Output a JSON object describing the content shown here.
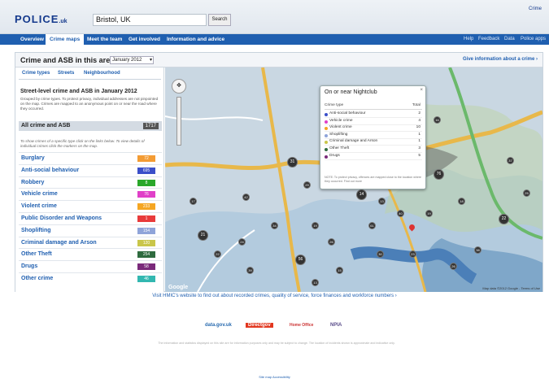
{
  "header": {
    "logo": "POLICE",
    "logo_suffix": ".uk",
    "search_value": "Bristol, UK",
    "search_button": "Search",
    "top_right_link": "Crime"
  },
  "nav": {
    "items": [
      "Overview",
      "Crime maps",
      "Meet the team",
      "Get involved",
      "Information and advice"
    ],
    "right_items": [
      "Help",
      "Feedback",
      "Data",
      "Police apps"
    ],
    "active": "Crime maps"
  },
  "panel": {
    "title": "Crime and ASB in this area in",
    "month": "January 2012",
    "info_link": "Give information about a crime ›"
  },
  "sidebar": {
    "tabs": [
      "Crime types",
      "Streets",
      "Neighbourhood"
    ],
    "heading": "Street-level crime and ASB in January 2012",
    "description": "Grouped by crime types. To protect privacy, individual addresses are not pinpointed on the map. Crimes are mapped to an anonymous point on or near the road where they occurred.",
    "all": {
      "label": "All crime and ASB",
      "count": "1717"
    },
    "hint": "To show crimes of a specific type click on the links below. To view details of individual crimes click the markers on the map.",
    "items": [
      {
        "label": "Burglary",
        "count": "72",
        "color": "#f39c34"
      },
      {
        "label": "Anti-social behaviour",
        "count": "695",
        "color": "#3a4fc9"
      },
      {
        "label": "Robbery",
        "count": "8",
        "color": "#2aa72a"
      },
      {
        "label": "Vehicle crime",
        "count": "76",
        "color": "#e040c8"
      },
      {
        "label": "Violent crime",
        "count": "233",
        "color": "#f5a623"
      },
      {
        "label": "Public Disorder and Weapons",
        "count": "1",
        "color": "#e83b3b"
      },
      {
        "label": "Shoplifting",
        "count": "154",
        "color": "#8fa4d9"
      },
      {
        "label": "Criminal damage and Arson",
        "count": "120",
        "color": "#c9c64a"
      },
      {
        "label": "Other Theft",
        "count": "254",
        "color": "#2f6b3f"
      },
      {
        "label": "Drugs",
        "count": "58",
        "color": "#7a2a7a"
      },
      {
        "label": "Other crime",
        "count": "46",
        "color": "#32b7b0"
      }
    ]
  },
  "popup": {
    "title": "On or near Nightclub",
    "close": "×",
    "col_type": "Crime type",
    "col_total": "Total",
    "rows": [
      {
        "label": "Anti-social behaviour",
        "total": "2",
        "color": "#3a4fc9"
      },
      {
        "label": "Vehicle crime",
        "total": "4",
        "color": "#e040c8"
      },
      {
        "label": "Violent crime",
        "total": "10",
        "color": "#f5a623"
      },
      {
        "label": "Shoplifting",
        "total": "1",
        "color": "#8fa4d9"
      },
      {
        "label": "Criminal damage and Arson",
        "total": "1",
        "color": "#c9c64a"
      },
      {
        "label": "Other Theft",
        "total": "3",
        "color": "#2f6b3f"
      },
      {
        "label": "Drugs",
        "total": "5",
        "color": "#7a2a7a"
      }
    ],
    "note": "NOTE: To protect privacy, offences are mapped close to the location where they occurred. Find out more"
  },
  "map": {
    "google": "Google",
    "copyright": "Map data ©2012 Google - Terms of Use",
    "markers": [
      "14",
      "13",
      "19",
      "26",
      "34",
      "56",
      "39",
      "61",
      "40",
      "19",
      "76",
      "24",
      "22",
      "30",
      "15",
      "21",
      "38",
      "23",
      "26",
      "17",
      "31",
      "29",
      "16",
      "42",
      "37",
      "22",
      "18",
      "25",
      "13"
    ]
  },
  "footer": {
    "hmic": "Visit HMIC's website to find out about recorded crimes, quality of service, force finances and workforce numbers ›",
    "logos": [
      "data.gov.uk",
      "Directgov",
      "Home Office",
      "NPIA"
    ],
    "text": "The information and statistics displayed on this site are for information purposes only and may be subject to change. The location of incidents shown is approximate and indicative only.",
    "links": "Site map   Accessibility"
  }
}
